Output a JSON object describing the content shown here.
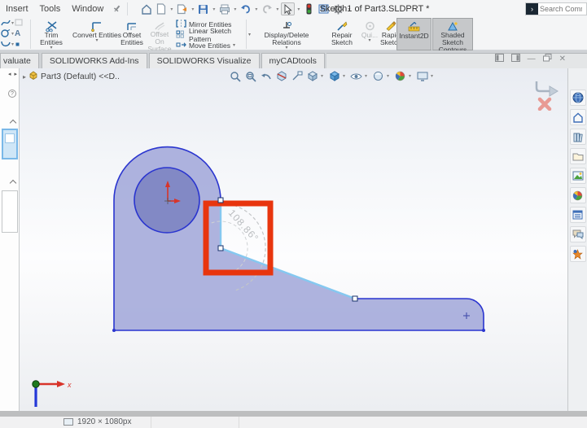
{
  "titlebar": {
    "menus": [
      {
        "label": "Insert"
      },
      {
        "label": "Tools"
      },
      {
        "label": "Window"
      }
    ],
    "title": "Sketch1 of Part3.SLDPRT *",
    "search_placeholder": "Search Comma",
    "qat_icons": [
      "home-icon",
      "new-document-icon",
      "open-icon",
      "save-icon",
      "print-icon",
      "undo-icon",
      "redo-icon",
      "select-cursor-icon",
      "selection-filter-icon",
      "options-list-icon",
      "settings-gear-icon"
    ]
  },
  "toolbar": {
    "buttons": [
      {
        "label": "Trim Entities",
        "state": "enabled"
      },
      {
        "label": "Convert Entities",
        "state": "enabled"
      },
      {
        "label": "Offset Entities",
        "state": "enabled"
      },
      {
        "label": "Offset On Surface",
        "state": "disabled"
      },
      {
        "label": "Mirror Entities",
        "state": "enabled"
      },
      {
        "label": "Linear Sketch Pattern",
        "state": "enabled"
      },
      {
        "label": "Move Entities",
        "state": "enabled"
      },
      {
        "label": "Display/Delete Relations",
        "state": "enabled"
      },
      {
        "label": "Repair Sketch",
        "state": "enabled"
      },
      {
        "label": "Qui...",
        "state": "disabled"
      },
      {
        "label": "Rapid Sketch",
        "state": "enabled"
      },
      {
        "label": "Instant2D",
        "state": "active"
      },
      {
        "label": "Shaded Sketch Contours",
        "state": "active"
      }
    ]
  },
  "tabs": [
    {
      "label": "valuate"
    },
    {
      "label": "SOLIDWORKS Add-Ins"
    },
    {
      "label": "SOLIDWORKS Visualize"
    },
    {
      "label": "myCADtools"
    }
  ],
  "feature_tree": {
    "root_label": "Part3 (Default) <<D.."
  },
  "sketch": {
    "angle_dimension": "108.86°",
    "axis_label": "x",
    "colors": {
      "shape_fill": "#a3a8d9",
      "inner_circle_fill": "#8289c5",
      "outline": "#2a35cf",
      "selected_edge": "#85c8f0",
      "highlight_box": "#e8350e",
      "dimension_text": "#b9bcbf"
    }
  },
  "headsup_icons": [
    "zoom-fit-icon",
    "zoom-area-icon",
    "previous-view-icon",
    "section-view-icon",
    "view-orientation-icon",
    "display-style-icon",
    "hide-show-icon",
    "edit-appearance-icon",
    "apply-scene-icon",
    "view-settings-icon"
  ],
  "taskpane_icons": [
    "resources-globe-icon",
    "design-library-home-icon",
    "library-icon",
    "file-explorer-folder-icon",
    "view-palette-icon",
    "appearances-ball-icon",
    "custom-properties-icon",
    "forum-icon",
    "xpress-products-icon"
  ],
  "statusbar": {
    "resolution": "1920 × 1080px"
  }
}
